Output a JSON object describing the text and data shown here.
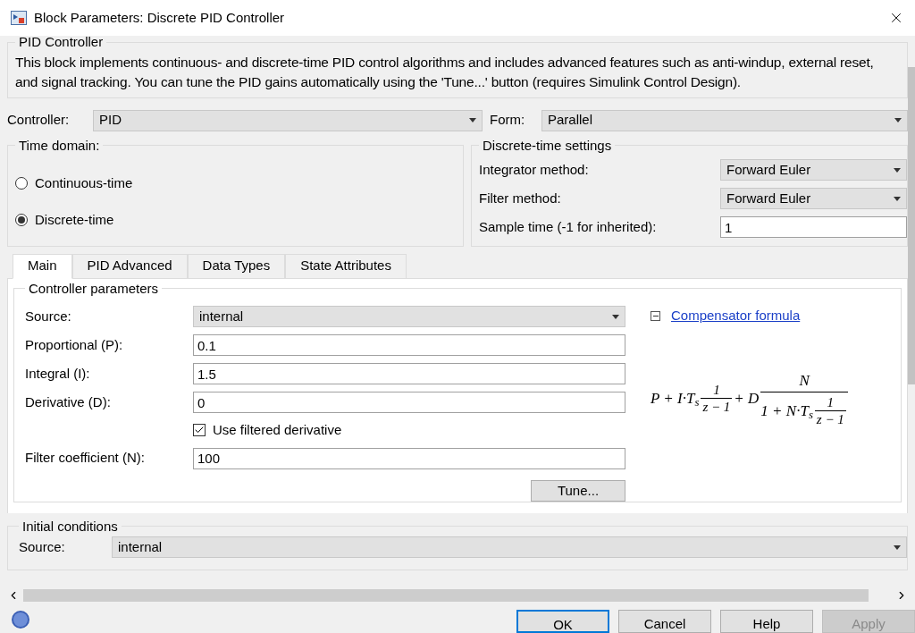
{
  "window": {
    "title": "Block Parameters: Discrete PID Controller"
  },
  "description_group": {
    "title": "PID Controller",
    "text": "This block implements continuous- and discrete-time PID control algorithms and includes advanced features such as anti-windup, external reset, and signal tracking. You can tune the PID gains automatically using the 'Tune...' button (requires Simulink Control Design)."
  },
  "controller": {
    "label": "Controller:",
    "value": "PID"
  },
  "form": {
    "label": "Form:",
    "value": "Parallel"
  },
  "time_domain": {
    "title": "Time domain:",
    "options": [
      {
        "label": "Continuous-time",
        "selected": false
      },
      {
        "label": "Discrete-time",
        "selected": true
      }
    ]
  },
  "discrete_settings": {
    "title": "Discrete-time settings",
    "rows": [
      {
        "kind": "dropdown",
        "label": "Integrator method:",
        "value": "Forward Euler"
      },
      {
        "kind": "dropdown",
        "label": "Filter method:",
        "value": "Forward Euler"
      },
      {
        "kind": "input",
        "label": "Sample time (-1 for inherited):",
        "value": "1"
      }
    ]
  },
  "tabs": [
    {
      "label": "Main",
      "selected": true
    },
    {
      "label": "PID Advanced",
      "selected": false
    },
    {
      "label": "Data Types",
      "selected": false
    },
    {
      "label": "State Attributes",
      "selected": false
    }
  ],
  "controller_parameters": {
    "title": "Controller parameters",
    "rows": [
      {
        "kind": "dropdown",
        "label": "Source:",
        "value": "internal"
      },
      {
        "kind": "input",
        "label": "Proportional (P):",
        "value": "0.1"
      },
      {
        "kind": "input",
        "label": "Integral (I):",
        "value": "1.5"
      },
      {
        "kind": "input",
        "label": "Derivative (D):",
        "value": "0"
      },
      {
        "kind": "checkbox",
        "label": "Use filtered derivative",
        "checked": true
      },
      {
        "kind": "input",
        "label": "Filter coefficient (N):",
        "value": "100"
      }
    ],
    "tune_button": "Tune...",
    "formula_link": "Compensator formula",
    "formula_expanded": true,
    "formula": {
      "lead": "P + I·T$_{s}$",
      "frac1_num": "1",
      "frac1_den": "z − 1",
      "mid": "+ D",
      "frac2_num": "N",
      "frac2_den_lead": "1 + N·T$_{s}$",
      "frac3_num": "1",
      "frac3_den": "z − 1"
    }
  },
  "initial_conditions": {
    "title": "Initial conditions",
    "label": "Source:",
    "value": "internal"
  },
  "buttons": [
    {
      "label": "OK",
      "kind": "default"
    },
    {
      "label": "Cancel",
      "kind": "normal"
    },
    {
      "label": "Help",
      "kind": "normal"
    },
    {
      "label": "Apply",
      "kind": "disabled"
    }
  ]
}
